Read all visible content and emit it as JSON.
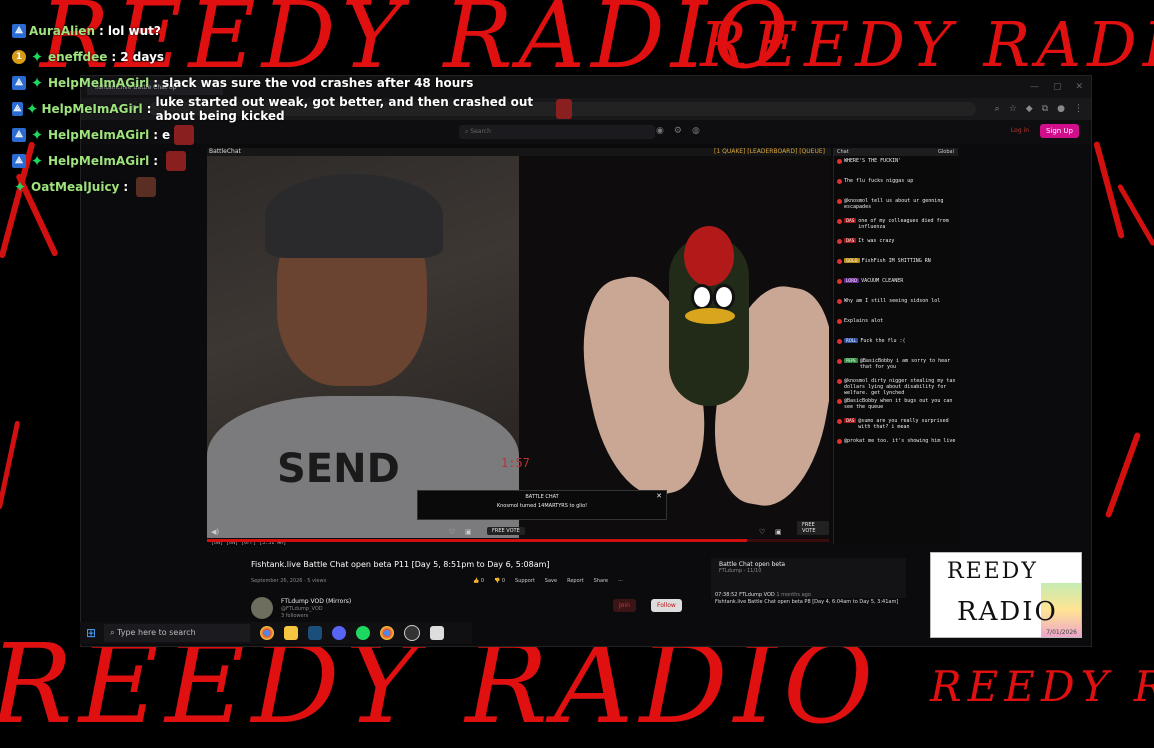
{
  "overlay": {
    "wordmark": "REEDY RADIO",
    "colors": {
      "brand_red": "#e01010",
      "name_green": "#9ee37d"
    }
  },
  "stream_chat": [
    {
      "badges": [
        "blue"
      ],
      "name": "AuraAlien",
      "text": "lol wut?",
      "emote": false
    },
    {
      "badges": [
        "gold",
        "green"
      ],
      "name": "eneffdee",
      "text": "2 days",
      "emote": false
    },
    {
      "badges": [
        "blue",
        "green"
      ],
      "name": "HelpMeImAGirl",
      "text": "slack was sure the vod crashes after 48 hours",
      "emote": false
    },
    {
      "badges": [
        "blue",
        "green"
      ],
      "name": "HelpMeImAGirl",
      "text": "luke started out weak, got better, and then crashed out about being kicked",
      "emote": true
    },
    {
      "badges": [
        "blue",
        "green"
      ],
      "name": "HelpMeImAGirl",
      "text": "e",
      "emote": true
    },
    {
      "badges": [
        "blue",
        "green"
      ],
      "name": "HelpMeImAGirl",
      "text": "",
      "emote": true
    },
    {
      "badges": [
        "green"
      ],
      "name": "OatMealJuicy",
      "text": "",
      "emote": true
    }
  ],
  "browser": {
    "tab_title": "fishtank.live Battle Chat op",
    "search_placeholder": "Search",
    "login_label": "Log in",
    "signup_label": "Sign Up"
  },
  "stream": {
    "header_left": "BattleChat",
    "header_right": "[1 QUAKE] [LEADERBOARD] [QUEUE]",
    "timer": "1:57",
    "shirt_text": "SEND",
    "popup_title": "BATTLE CHAT",
    "popup_text": "Knosmol turned 14MARTYRS to glio!",
    "vote_label": "FREE VOTE",
    "controls_text": "[ON] [ON] [OFF] [3:31 AM]"
  },
  "side_chat": {
    "header": "Chat",
    "header_right": "Global",
    "lines": [
      {
        "tag": "",
        "text": "WHERE'S THE FUCKIN'"
      },
      {
        "tag": "",
        "text": "The flu fucks niggas up"
      },
      {
        "tag": "",
        "text": "@knosmol tell us about ur genning escapades"
      },
      {
        "tag": "DAS",
        "text": "one of my colleagues died from influenza"
      },
      {
        "tag": "DAS",
        "text": "It was crazy"
      },
      {
        "tag": "GOLD",
        "text": "FishFish IM SHITTING RN"
      },
      {
        "tag": "LORD",
        "text": "VACUUM CLEANER"
      },
      {
        "tag": "",
        "text": "Why am I still seeing sidson lol"
      },
      {
        "tag": "",
        "text": "Explains alot"
      },
      {
        "tag": "ROLL",
        "text": "Fuck the flu :("
      },
      {
        "tag": "PEPE",
        "text": "@BasicBobby i am sorry to hear that for you"
      },
      {
        "tag": "",
        "text": "@knosmol dirty nigger stealing my tax dollars lying about disability for welfare. get lynched"
      },
      {
        "tag": "",
        "text": "@BasicBobby when it bugs out you can see the queue"
      },
      {
        "tag": "DAS",
        "text": "@sumo are you really surprised with that? i mean"
      },
      {
        "tag": "",
        "text": "@prokat me too. it's showing him live"
      }
    ]
  },
  "video_page": {
    "title": "Fishtank.live Battle Chat open beta P11 [Day 5, 8:51pm to Day 6, 5:08am]",
    "date": "September 26, 2026",
    "views": "5 views",
    "likes": "0",
    "dislikes": "0",
    "support_label": "Support",
    "save_label": "Save",
    "report_label": "Report",
    "share_label": "Share",
    "channel_name": "FTLdump VOD (Mirrors)",
    "channel_handle": "@FTLdump_VOD",
    "subscribers": "3 followers",
    "join_label": "Join",
    "follow_label": "Follow",
    "upnext_title": "Battle Chat open beta",
    "upnext_sub": "FTLdump - 11/10",
    "rec_title": "Fishtank.live Battle Chat open beta P8 [Day 4, 6:04am to Day 5, 3:41am]",
    "rec_meta": "FTLdump VOD",
    "rec_time": "07:38:52",
    "rec_age": "1 months ago"
  },
  "taskbar": {
    "search_placeholder": "Type here to search",
    "apps": [
      "chrome-icon",
      "files-icon",
      "steam-icon",
      "discord-icon",
      "spotify-icon",
      "chrome-icon",
      "obs-icon",
      "app-icon"
    ]
  },
  "logo": {
    "line1": "REEDY",
    "line2": "RADIO",
    "date": "7/01/2026"
  }
}
